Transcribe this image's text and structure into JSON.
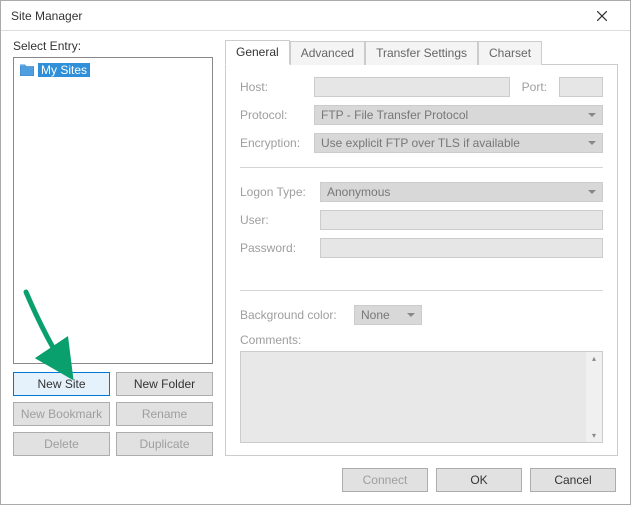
{
  "window": {
    "title": "Site Manager"
  },
  "left": {
    "select_entry_label": "Select Entry:",
    "tree_items": [
      {
        "label": "My Sites"
      }
    ],
    "buttons": {
      "new_site": "New Site",
      "new_folder": "New Folder",
      "new_bookmark": "New Bookmark",
      "rename": "Rename",
      "delete": "Delete",
      "duplicate": "Duplicate"
    }
  },
  "tabs": {
    "general": "General",
    "advanced": "Advanced",
    "transfer_settings": "Transfer Settings",
    "charset": "Charset"
  },
  "general": {
    "host_label": "Host:",
    "host_value": "",
    "port_label": "Port:",
    "port_value": "",
    "protocol_label": "Protocol:",
    "protocol_value": "FTP - File Transfer Protocol",
    "encryption_label": "Encryption:",
    "encryption_value": "Use explicit FTP over TLS if available",
    "logon_type_label": "Logon Type:",
    "logon_type_value": "Anonymous",
    "user_label": "User:",
    "user_value": "",
    "password_label": "Password:",
    "password_value": "",
    "bg_color_label": "Background color:",
    "bg_color_value": "None",
    "comments_label": "Comments:",
    "comments_value": ""
  },
  "footer": {
    "connect": "Connect",
    "ok": "OK",
    "cancel": "Cancel"
  }
}
